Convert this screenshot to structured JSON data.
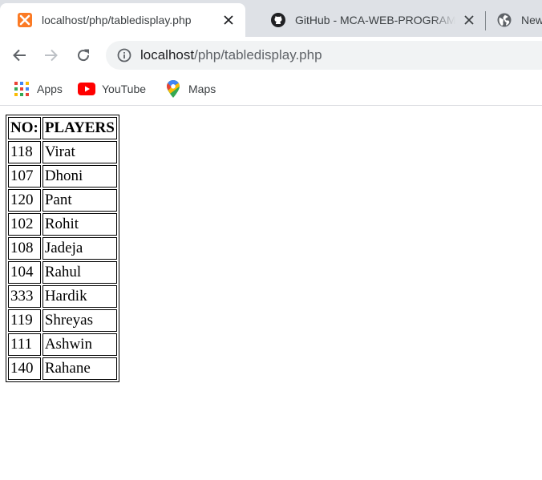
{
  "tabs": [
    {
      "title": "localhost/php/tabledisplay.php",
      "favicon": "xampp-icon",
      "active": true
    },
    {
      "title": "GitHub - MCA-WEB-PROGRAMMING",
      "favicon": "github-icon",
      "active": false
    },
    {
      "title": "New",
      "favicon": "globe-icon",
      "active": false
    }
  ],
  "omnibox": {
    "host": "localhost",
    "path": "/php/tabledisplay.php"
  },
  "bookmarks": [
    {
      "label": "Apps",
      "icon": "apps-grid-icon"
    },
    {
      "label": "YouTube",
      "icon": "youtube-icon"
    },
    {
      "label": "Maps",
      "icon": "maps-pin-icon"
    }
  ],
  "table": {
    "headers": [
      "NO:",
      "PLAYERS"
    ],
    "rows": [
      [
        "118",
        "Virat"
      ],
      [
        "107",
        "Dhoni"
      ],
      [
        "120",
        "Pant"
      ],
      [
        "102",
        "Rohit"
      ],
      [
        "108",
        "Jadeja"
      ],
      [
        "104",
        "Rahul"
      ],
      [
        "333",
        "Hardik"
      ],
      [
        "119",
        "Shreyas"
      ],
      [
        "111",
        "Ashwin"
      ],
      [
        "140",
        "Rahane"
      ]
    ]
  }
}
